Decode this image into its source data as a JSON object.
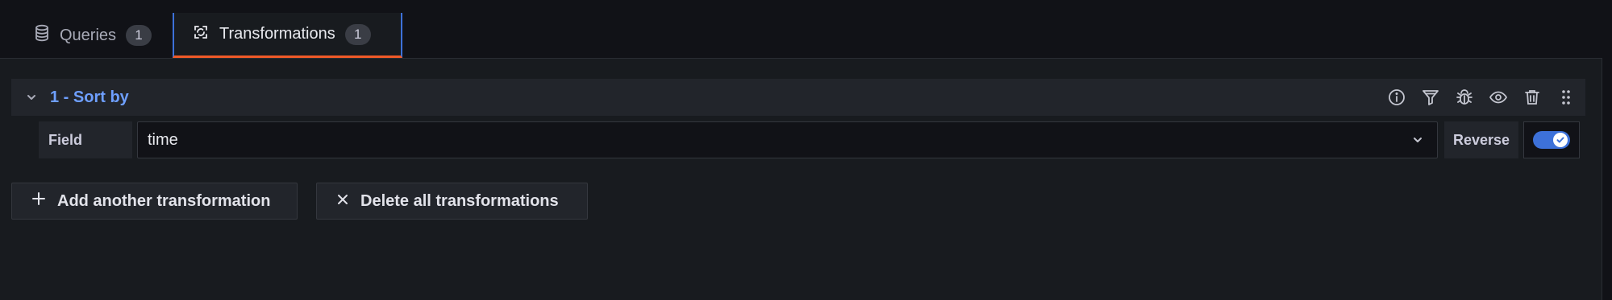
{
  "tabs": [
    {
      "label": "Queries",
      "count": "1",
      "icon": "database-icon"
    },
    {
      "label": "Transformations",
      "count": "1",
      "icon": "transform-icon"
    }
  ],
  "transformation": {
    "title": "1 - Sort by",
    "actions": [
      "info-icon",
      "filter-icon",
      "debug-icon",
      "eye-icon",
      "trash-icon",
      "drag-handle-icon"
    ],
    "field_label": "Field",
    "field_value": "time",
    "reverse_label": "Reverse",
    "reverse_enabled": true
  },
  "buttons": {
    "add": "Add another transformation",
    "delete": "Delete all transformations"
  },
  "colors": {
    "background": "#111217",
    "panel": "#181b1f",
    "accent_blue": "#3d71d9",
    "accent_orange": "#f05a28",
    "title_blue": "#6e9fff"
  }
}
